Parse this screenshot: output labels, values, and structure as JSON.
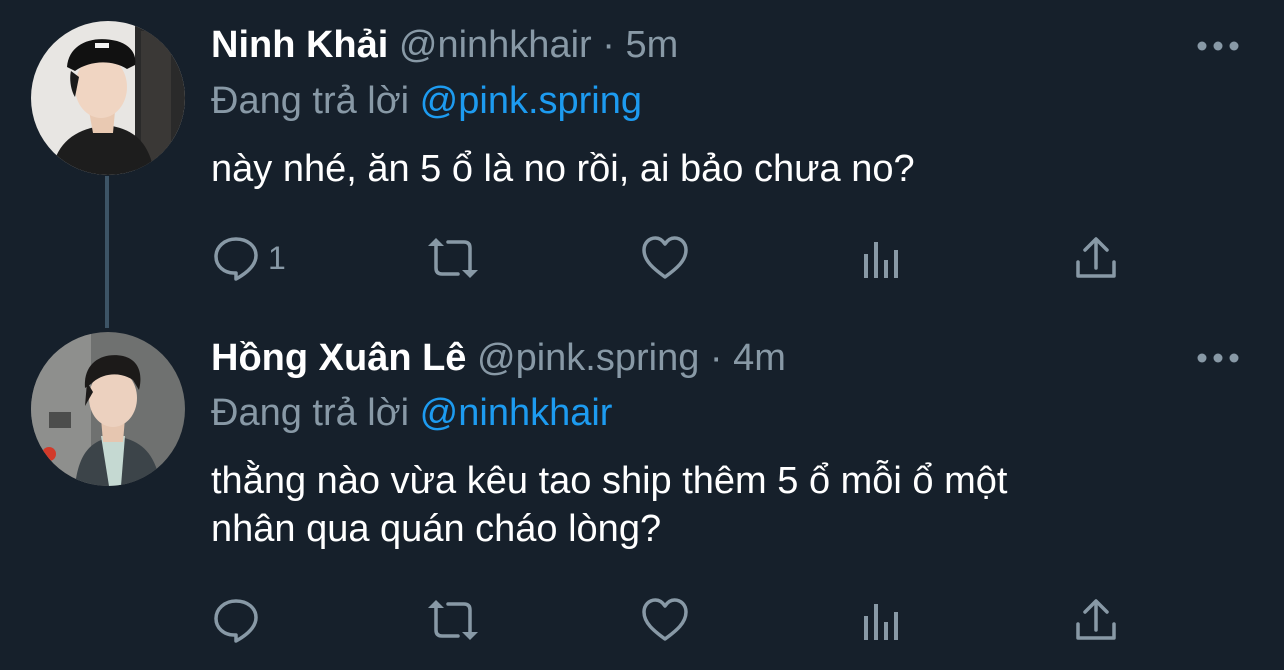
{
  "tweets": [
    {
      "name": "Ninh Khải",
      "handle": "@ninhkhair",
      "time": "· 5m",
      "reply_prefix": "Đang trả lời",
      "reply_to": "@pink.spring",
      "text_lines": [
        "này nhé, ăn 5 ổ là no rồi, ai bảo chưa no?"
      ],
      "reply_count": "1"
    },
    {
      "name": "Hồng Xuân Lê",
      "handle": "@pink.spring",
      "time": "· 4m",
      "reply_prefix": "Đang trả lời",
      "reply_to": "@ninhkhair",
      "text_lines": [
        "thằng nào vừa kêu tao ship thêm 5 ổ mỗi ổ một",
        "nhân qua quán cháo lòng?"
      ],
      "reply_count": ""
    }
  ],
  "icons": {
    "more": "more-horizontal-icon",
    "reply": "reply-bubble-icon",
    "retweet": "retweet-icon",
    "like": "heart-icon",
    "stats": "analytics-icon",
    "share": "share-icon"
  },
  "colors": {
    "background": "#16202b",
    "text": "#ffffff",
    "secondary": "#8899a6",
    "link": "#1d9bf0",
    "thread_line": "#3d5466"
  }
}
